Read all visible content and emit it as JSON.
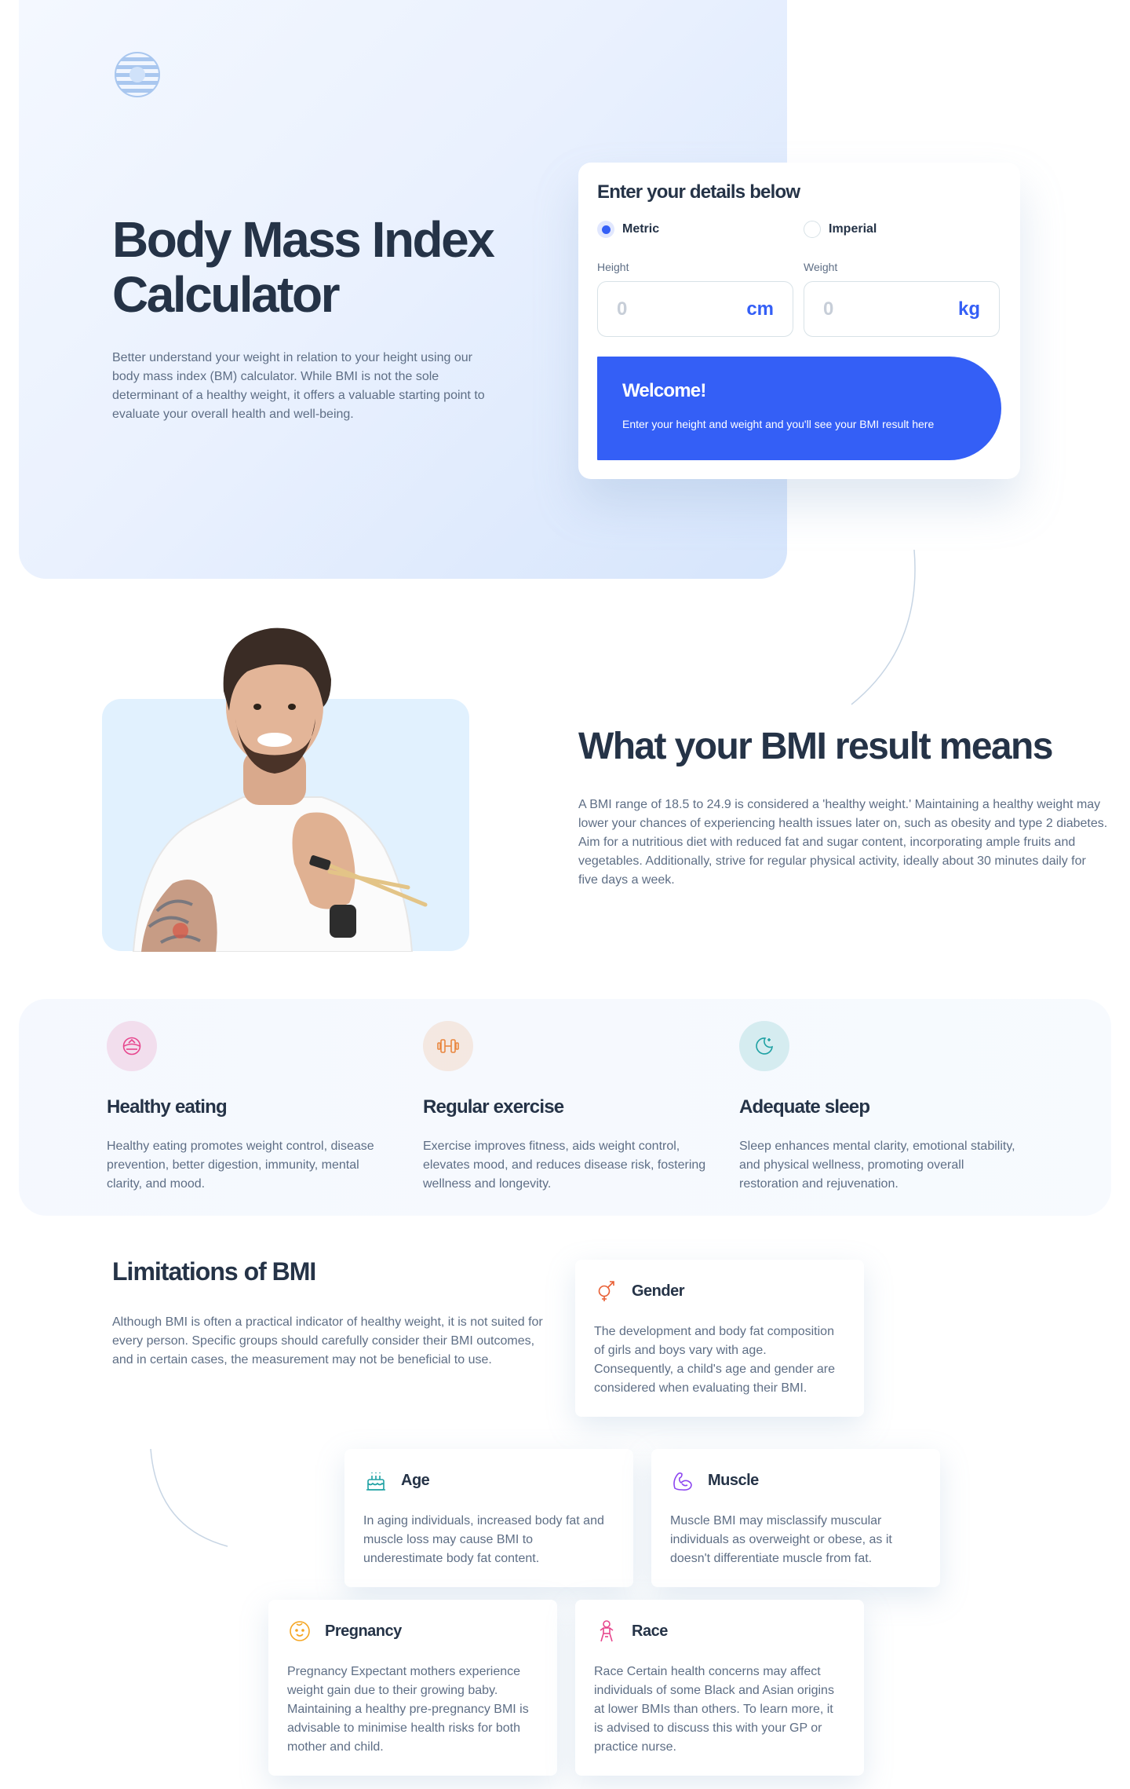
{
  "hero": {
    "title": "Body Mass Index Calculator",
    "description": "Better understand your weight in relation to your height using our body mass index (BM) calculator. While BMI is not the sole determinant of a healthy weight, it offers a valuable starting point to evaluate your overall health and well-being."
  },
  "calculator": {
    "title": "Enter your details below",
    "unit_options": [
      {
        "label": "Metric",
        "selected": true
      },
      {
        "label": "Imperial",
        "selected": false
      }
    ],
    "height_label": "Height",
    "height_value": "0",
    "height_unit": "cm",
    "weight_label": "Weight",
    "weight_value": "0",
    "weight_unit": "kg",
    "result_title": "Welcome!",
    "result_text": "Enter your height and weight and you'll see your BMI result here"
  },
  "meaning": {
    "title": "What your BMI result means",
    "text": "A BMI range of 18.5 to 24.9 is considered a 'healthy weight.' Maintaining a healthy weight may lower your chances of experiencing health issues later on, such as obesity and type 2 diabetes. Aim for a nutritious diet with reduced fat and sugar content, incorporating ample fruits and vegetables. Additionally, strive for regular physical activity, ideally about 30 minutes daily for five days a week."
  },
  "tips": [
    {
      "icon": "bowl-icon",
      "title": "Healthy eating",
      "text": "Healthy eating promotes weight control, disease prevention, better digestion, immunity, mental clarity, and mood.",
      "color": "#e7468d"
    },
    {
      "icon": "dumbbell-icon",
      "title": "Regular exercise",
      "text": "Exercise improves fitness, aids weight control, elevates mood, and reduces disease risk, fostering wellness and longevity.",
      "color": "#e9863f"
    },
    {
      "icon": "moon-icon",
      "title": "Adequate sleep",
      "text": "Sleep enhances mental clarity, emotional stability, and physical wellness, promoting overall restoration and rejuvenation.",
      "color": "#1ea1a3"
    }
  ],
  "limitations": {
    "title": "Limitations of BMI",
    "text": "Although BMI is often a practical indicator of healthy weight, it is not suited for every person. Specific groups should carefully consider their BMI outcomes, and in certain cases, the measurement may not be beneficial to use.",
    "cards": {
      "gender": {
        "title": "Gender",
        "text": "The development and body fat composition of girls and boys vary with age. Consequently, a child's age and gender are considered when evaluating their BMI."
      },
      "age": {
        "title": "Age",
        "text": "In aging individuals, increased body fat and muscle loss may cause BMI to underestimate body fat content."
      },
      "muscle": {
        "title": "Muscle",
        "text": "Muscle BMI may misclassify muscular individuals as overweight or obese, as it doesn't differentiate muscle from fat."
      },
      "pregnancy": {
        "title": "Pregnancy",
        "text": "Pregnancy Expectant mothers experience weight gain due to their growing baby. Maintaining a healthy pre-pregnancy BMI is advisable to minimise health risks for both mother and child."
      },
      "race": {
        "title": "Race",
        "text": "Race Certain health concerns may affect individuals of some Black and Asian origins at lower BMIs than others. To learn more, it is advised to discuss this with your GP or practice nurse."
      }
    }
  },
  "colors": {
    "primary": "#345ff6",
    "gunmetal": "#253347",
    "dark_electric_blue": "#5e6e85",
    "borders": "#d8e2e7"
  }
}
